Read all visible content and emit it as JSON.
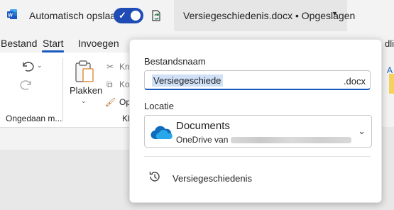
{
  "titlebar": {
    "autosave_label": "Automatisch opslaan",
    "autosave_state": "on",
    "document_title": "Versiegeschiedenis.docx • Opgeslagen"
  },
  "tabs": [
    "Bestand",
    "Start",
    "Invoegen"
  ],
  "active_tab": "Start",
  "edge": {
    "tab_fragment": "dli",
    "letter": "A"
  },
  "ribbon": {
    "undo_group_label": "Ongedaan m...",
    "paste_label": "Plakken",
    "cut_label": "Kn",
    "copy_label": "Ko",
    "format_painter_label": "Op",
    "clipboard_group_fragment": "Kl"
  },
  "flyout": {
    "filename_label": "Bestandsnaam",
    "filename_value": "Versiegeschiedenis",
    "filename_ext": ".docx",
    "location_label": "Locatie",
    "location_name": "Documents",
    "location_sub": "OneDrive van",
    "version_history_label": "Versiegeschiedenis"
  },
  "colors": {
    "accent": "#185abd",
    "toggle": "#1f4bb5",
    "onedrive": "#0f6cbd"
  },
  "icons": [
    "word-logo-icon",
    "sync-icon",
    "undo-icon",
    "redo-icon",
    "paste-icon",
    "cut-icon",
    "copy-icon",
    "format-painter-icon",
    "onedrive-cloud-icon",
    "chevron-down-icon",
    "history-icon"
  ]
}
